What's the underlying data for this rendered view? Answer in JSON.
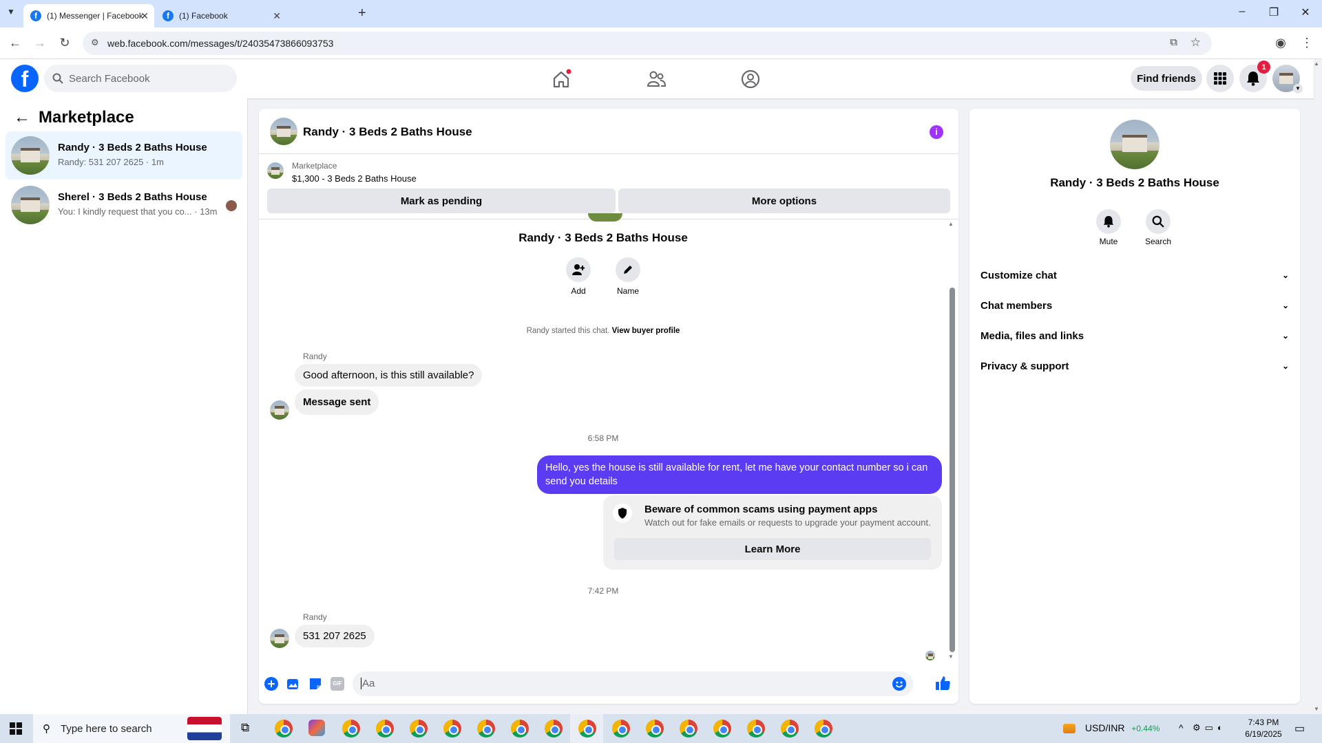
{
  "browser": {
    "tabs": [
      {
        "label": "(1) Messenger | Facebook",
        "active": true
      },
      {
        "label": "(1) Facebook",
        "active": false
      }
    ],
    "url": "web.facebook.com/messages/t/24035473866093753"
  },
  "header": {
    "search_placeholder": "Search Facebook",
    "find_friends": "Find friends",
    "notification_count": "1"
  },
  "sidebar": {
    "title": "Marketplace",
    "conversations": [
      {
        "name": "Randy · 3 Beds 2 Baths House",
        "preview": "Randy: 531 207 2625 · 1m"
      },
      {
        "name": "Sherel · 3 Beds 2 Baths House",
        "preview": "You: I kindly request that you co... · 13m"
      }
    ]
  },
  "chat": {
    "title": "Randy · 3 Beds 2 Baths House",
    "listing": {
      "label": "Marketplace",
      "detail": "$1,300 - 3 Beds 2 Baths House",
      "mark_pending": "Mark as pending",
      "more_options": "More options"
    },
    "intro_name": "Randy · 3 Beds 2 Baths House",
    "actions": {
      "add": "Add",
      "name": "Name"
    },
    "started_text": "Randy started this chat.",
    "view_profile": "View buyer profile",
    "sender1": "Randy",
    "msg1": "Good afternoon, is this still available?",
    "msg2": "Message sent",
    "time1": "6:58 PM",
    "out_msg": "Hello, yes the house is still available for rent, let me have your contact number so i can send you  details",
    "scam": {
      "title": "Beware of common scams using payment apps",
      "body": "Watch out for fake emails or requests to upgrade your payment account.",
      "button": "Learn More"
    },
    "time2": "7:42 PM",
    "sender2": "Randy",
    "msg3": "531 207 2625",
    "composer_placeholder": "Aa"
  },
  "details": {
    "name": "Randy · 3 Beds 2 Baths House",
    "mute": "Mute",
    "search": "Search",
    "sections": [
      "Customize chat",
      "Chat members",
      "Media, files and links",
      "Privacy & support"
    ]
  },
  "taskbar": {
    "search_placeholder": "Type here to search",
    "ticker": "USD/INR",
    "ticker_change": "+0.44%",
    "time": "7:43 PM",
    "date": "6/19/2025"
  },
  "colors": {
    "accent": "#0866ff",
    "outgoing_bubble": "#5b3cf2",
    "badge": "#e41e3f",
    "ticker_positive": "#0f9d58"
  }
}
